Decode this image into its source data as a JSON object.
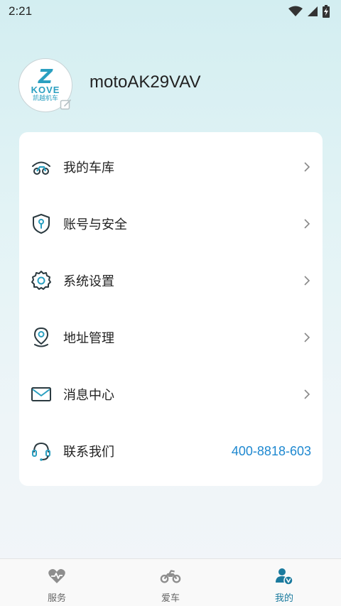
{
  "status_bar": {
    "time": "2:21"
  },
  "profile": {
    "avatar": {
      "logo_mark": "Z",
      "brand": "KOVE",
      "brand_sub": "凯越机车"
    },
    "username": "motoAK29VAV"
  },
  "menu": {
    "items": [
      {
        "label": "我的车库",
        "icon": "motorcycle-garage-icon"
      },
      {
        "label": "账号与安全",
        "icon": "shield-key-icon"
      },
      {
        "label": "系统设置",
        "icon": "gear-icon"
      },
      {
        "label": "地址管理",
        "icon": "location-pin-icon"
      },
      {
        "label": "消息中心",
        "icon": "envelope-icon"
      },
      {
        "label": "联系我们",
        "icon": "headset-icon",
        "value": "400-8818-603"
      }
    ]
  },
  "tabs": [
    {
      "label": "服务",
      "icon": "heart-service-icon",
      "active": false
    },
    {
      "label": "爱车",
      "icon": "motorcycle-icon",
      "active": false
    },
    {
      "label": "我的",
      "icon": "user-verified-icon",
      "active": true
    }
  ],
  "colors": {
    "accent": "#2a9fc0",
    "link": "#1e88d0",
    "active_tab": "#1a7a9e"
  }
}
